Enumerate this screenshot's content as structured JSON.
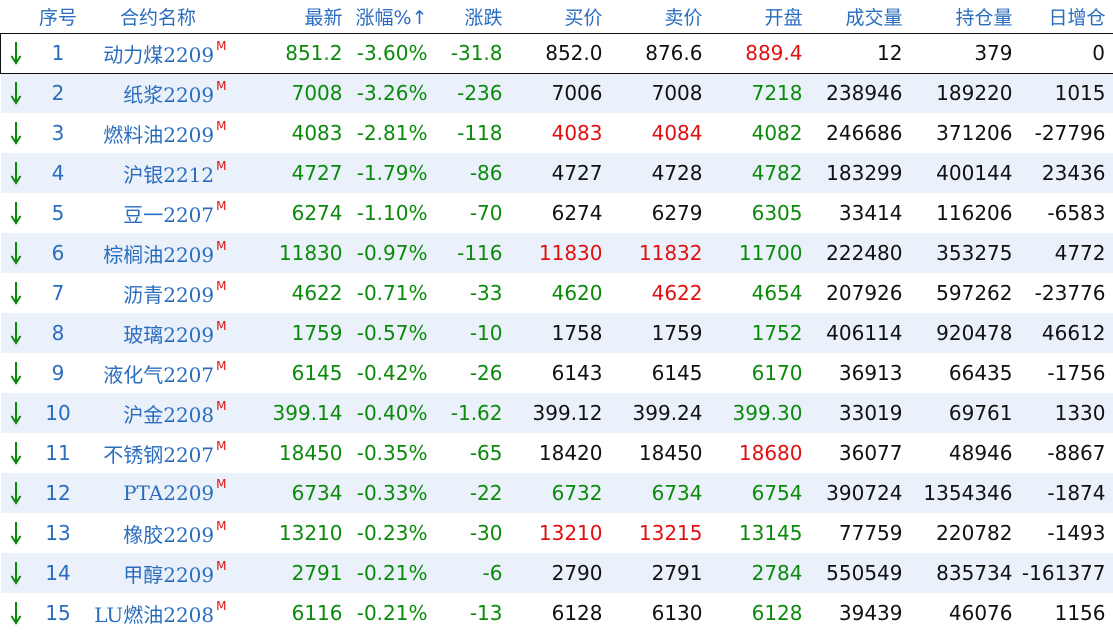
{
  "header": {
    "seq": "序号",
    "name": "合约名称",
    "last": "最新",
    "change_pct": "涨幅%",
    "sort_arrow": "↑",
    "change": "涨跌",
    "bid": "买价",
    "ask": "卖价",
    "open": "开盘",
    "volume": "成交量",
    "open_interest": "持仓量",
    "oi_change": "日增仓"
  },
  "colors": {
    "up": "#e01010",
    "down": "#0a8a0a",
    "flat": "#111111",
    "label": "#2a6dbf"
  },
  "row_icon": "down-arrow-icon",
  "rows": [
    {
      "seq": "1",
      "name": "动力煤2209",
      "tag": "M",
      "last": "851.2",
      "change_pct": "-3.60%",
      "change": "-31.8",
      "bid": "852.0",
      "ask": "876.6",
      "open": "889.4",
      "volume": "12",
      "open_interest": "379",
      "oi_change": "0",
      "c_bid": "k",
      "c_ask": "k",
      "c_open": "r"
    },
    {
      "seq": "2",
      "name": "纸浆2209",
      "tag": "M",
      "last": "7008",
      "change_pct": "-3.26%",
      "change": "-236",
      "bid": "7006",
      "ask": "7008",
      "open": "7218",
      "volume": "238946",
      "open_interest": "189220",
      "oi_change": "1015",
      "c_bid": "k",
      "c_ask": "k",
      "c_open": "g"
    },
    {
      "seq": "3",
      "name": "燃料油2209",
      "tag": "M",
      "last": "4083",
      "change_pct": "-2.81%",
      "change": "-118",
      "bid": "4083",
      "ask": "4084",
      "open": "4082",
      "volume": "246686",
      "open_interest": "371206",
      "oi_change": "-27796",
      "c_bid": "r",
      "c_ask": "r",
      "c_open": "g"
    },
    {
      "seq": "4",
      "name": "沪银2212",
      "tag": "M",
      "last": "4727",
      "change_pct": "-1.79%",
      "change": "-86",
      "bid": "4727",
      "ask": "4728",
      "open": "4782",
      "volume": "183299",
      "open_interest": "400144",
      "oi_change": "23436",
      "c_bid": "k",
      "c_ask": "k",
      "c_open": "g"
    },
    {
      "seq": "5",
      "name": "豆一2207",
      "tag": "M",
      "last": "6274",
      "change_pct": "-1.10%",
      "change": "-70",
      "bid": "6274",
      "ask": "6279",
      "open": "6305",
      "volume": "33414",
      "open_interest": "116206",
      "oi_change": "-6583",
      "c_bid": "k",
      "c_ask": "k",
      "c_open": "g"
    },
    {
      "seq": "6",
      "name": "棕榈油2209",
      "tag": "M",
      "last": "11830",
      "change_pct": "-0.97%",
      "change": "-116",
      "bid": "11830",
      "ask": "11832",
      "open": "11700",
      "volume": "222480",
      "open_interest": "353275",
      "oi_change": "4772",
      "c_bid": "r",
      "c_ask": "r",
      "c_open": "g"
    },
    {
      "seq": "7",
      "name": "沥青2209",
      "tag": "M",
      "last": "4622",
      "change_pct": "-0.71%",
      "change": "-33",
      "bid": "4620",
      "ask": "4622",
      "open": "4654",
      "volume": "207926",
      "open_interest": "597262",
      "oi_change": "-23776",
      "c_bid": "g",
      "c_ask": "r",
      "c_open": "g"
    },
    {
      "seq": "8",
      "name": "玻璃2209",
      "tag": "M",
      "last": "1759",
      "change_pct": "-0.57%",
      "change": "-10",
      "bid": "1758",
      "ask": "1759",
      "open": "1752",
      "volume": "406114",
      "open_interest": "920478",
      "oi_change": "46612",
      "c_bid": "k",
      "c_ask": "k",
      "c_open": "g"
    },
    {
      "seq": "9",
      "name": "液化气2207",
      "tag": "M",
      "last": "6145",
      "change_pct": "-0.42%",
      "change": "-26",
      "bid": "6143",
      "ask": "6145",
      "open": "6170",
      "volume": "36913",
      "open_interest": "66435",
      "oi_change": "-1756",
      "c_bid": "k",
      "c_ask": "k",
      "c_open": "g"
    },
    {
      "seq": "10",
      "name": "沪金2208",
      "tag": "M",
      "last": "399.14",
      "change_pct": "-0.40%",
      "change": "-1.62",
      "bid": "399.12",
      "ask": "399.24",
      "open": "399.30",
      "volume": "33019",
      "open_interest": "69761",
      "oi_change": "1330",
      "c_bid": "k",
      "c_ask": "k",
      "c_open": "g"
    },
    {
      "seq": "11",
      "name": "不锈钢2207",
      "tag": "M",
      "last": "18450",
      "change_pct": "-0.35%",
      "change": "-65",
      "bid": "18420",
      "ask": "18450",
      "open": "18680",
      "volume": "36077",
      "open_interest": "48946",
      "oi_change": "-8867",
      "c_bid": "k",
      "c_ask": "k",
      "c_open": "r"
    },
    {
      "seq": "12",
      "name": "PTA2209",
      "tag": "M",
      "last": "6734",
      "change_pct": "-0.33%",
      "change": "-22",
      "bid": "6732",
      "ask": "6734",
      "open": "6754",
      "volume": "390724",
      "open_interest": "1354346",
      "oi_change": "-1874",
      "c_bid": "g",
      "c_ask": "g",
      "c_open": "g"
    },
    {
      "seq": "13",
      "name": "橡胶2209",
      "tag": "M",
      "last": "13210",
      "change_pct": "-0.23%",
      "change": "-30",
      "bid": "13210",
      "ask": "13215",
      "open": "13145",
      "volume": "77759",
      "open_interest": "220782",
      "oi_change": "-1493",
      "c_bid": "r",
      "c_ask": "r",
      "c_open": "g"
    },
    {
      "seq": "14",
      "name": "甲醇2209",
      "tag": "M",
      "last": "2791",
      "change_pct": "-0.21%",
      "change": "-6",
      "bid": "2790",
      "ask": "2791",
      "open": "2784",
      "volume": "550549",
      "open_interest": "835734",
      "oi_change": "-161377",
      "c_bid": "k",
      "c_ask": "k",
      "c_open": "g"
    },
    {
      "seq": "15",
      "name": "LU燃油2208",
      "tag": "M",
      "last": "6116",
      "change_pct": "-0.21%",
      "change": "-13",
      "bid": "6128",
      "ask": "6130",
      "open": "6128",
      "volume": "39439",
      "open_interest": "46076",
      "oi_change": "1156",
      "c_bid": "k",
      "c_ask": "k",
      "c_open": "g"
    }
  ]
}
